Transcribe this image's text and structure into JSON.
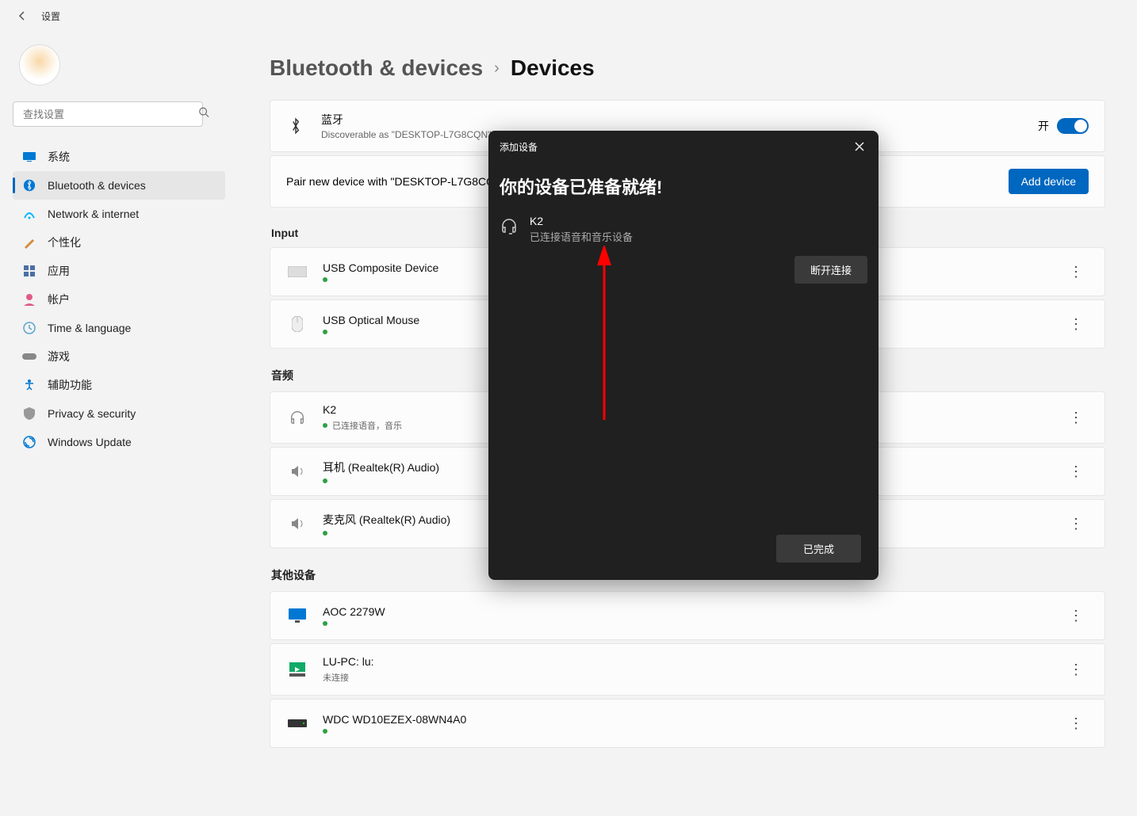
{
  "header": {
    "title": "设置"
  },
  "search": {
    "placeholder": "查找设置"
  },
  "nav": [
    {
      "key": "system",
      "label": "系统",
      "color": "#0078d4"
    },
    {
      "key": "bluetooth",
      "label": "Bluetooth & devices",
      "color": "#0078d4",
      "active": true
    },
    {
      "key": "network",
      "label": "Network & internet",
      "color": "#00b7ff"
    },
    {
      "key": "personalization",
      "label": "个性化",
      "color": "#d38b3b"
    },
    {
      "key": "apps",
      "label": "应用",
      "color": "#4a6fa5"
    },
    {
      "key": "accounts",
      "label": "帐户",
      "color": "#e05a8a"
    },
    {
      "key": "time",
      "label": "Time & language",
      "color": "#5aa6d0"
    },
    {
      "key": "gaming",
      "label": "游戏",
      "color": "#888"
    },
    {
      "key": "accessibility",
      "label": "辅助功能",
      "color": "#0078d4"
    },
    {
      "key": "privacy",
      "label": "Privacy & security",
      "color": "#888"
    },
    {
      "key": "update",
      "label": "Windows Update",
      "color": "#0078d4"
    }
  ],
  "breadcrumb": {
    "parent": "Bluetooth & devices",
    "sep": "›",
    "current": "Devices"
  },
  "bluetooth": {
    "title": "蓝牙",
    "subtitle": "Discoverable as \"DESKTOP-L7G8CQN\"",
    "toggle_label": "开"
  },
  "pair": {
    "text": "Pair new device with \"DESKTOP-L7G8CQN\"",
    "button": "Add device"
  },
  "sections": {
    "input": "Input",
    "audio": "音频",
    "other": "其他设备"
  },
  "devices": {
    "input": [
      {
        "name": "USB Composite Device",
        "status": "",
        "dot": true,
        "icon": "keyboard"
      },
      {
        "name": "USB Optical Mouse",
        "status": "",
        "dot": true,
        "icon": "mouse"
      }
    ],
    "audio": [
      {
        "name": "K2",
        "status": "已连接语音，音乐",
        "dot": true,
        "icon": "headphones"
      },
      {
        "name": "耳机 (Realtek(R) Audio)",
        "status": "",
        "dot": true,
        "icon": "speaker"
      },
      {
        "name": "麦克风 (Realtek(R) Audio)",
        "status": "",
        "dot": true,
        "icon": "speaker"
      }
    ],
    "other": [
      {
        "name": "AOC 2279W",
        "status": "",
        "dot": true,
        "icon": "monitor"
      },
      {
        "name": "LU-PC: lu:",
        "status": "未连接",
        "dot": false,
        "icon": "pc"
      },
      {
        "name": "WDC WD10EZEX-08WN4A0",
        "status": "",
        "dot": true,
        "icon": "drive"
      }
    ]
  },
  "dialog": {
    "header": "添加设备",
    "title": "你的设备已准备就绪!",
    "device_name": "K2",
    "device_sub": "已连接语音和音乐设备",
    "disconnect": "断开连接",
    "done": "已完成"
  }
}
